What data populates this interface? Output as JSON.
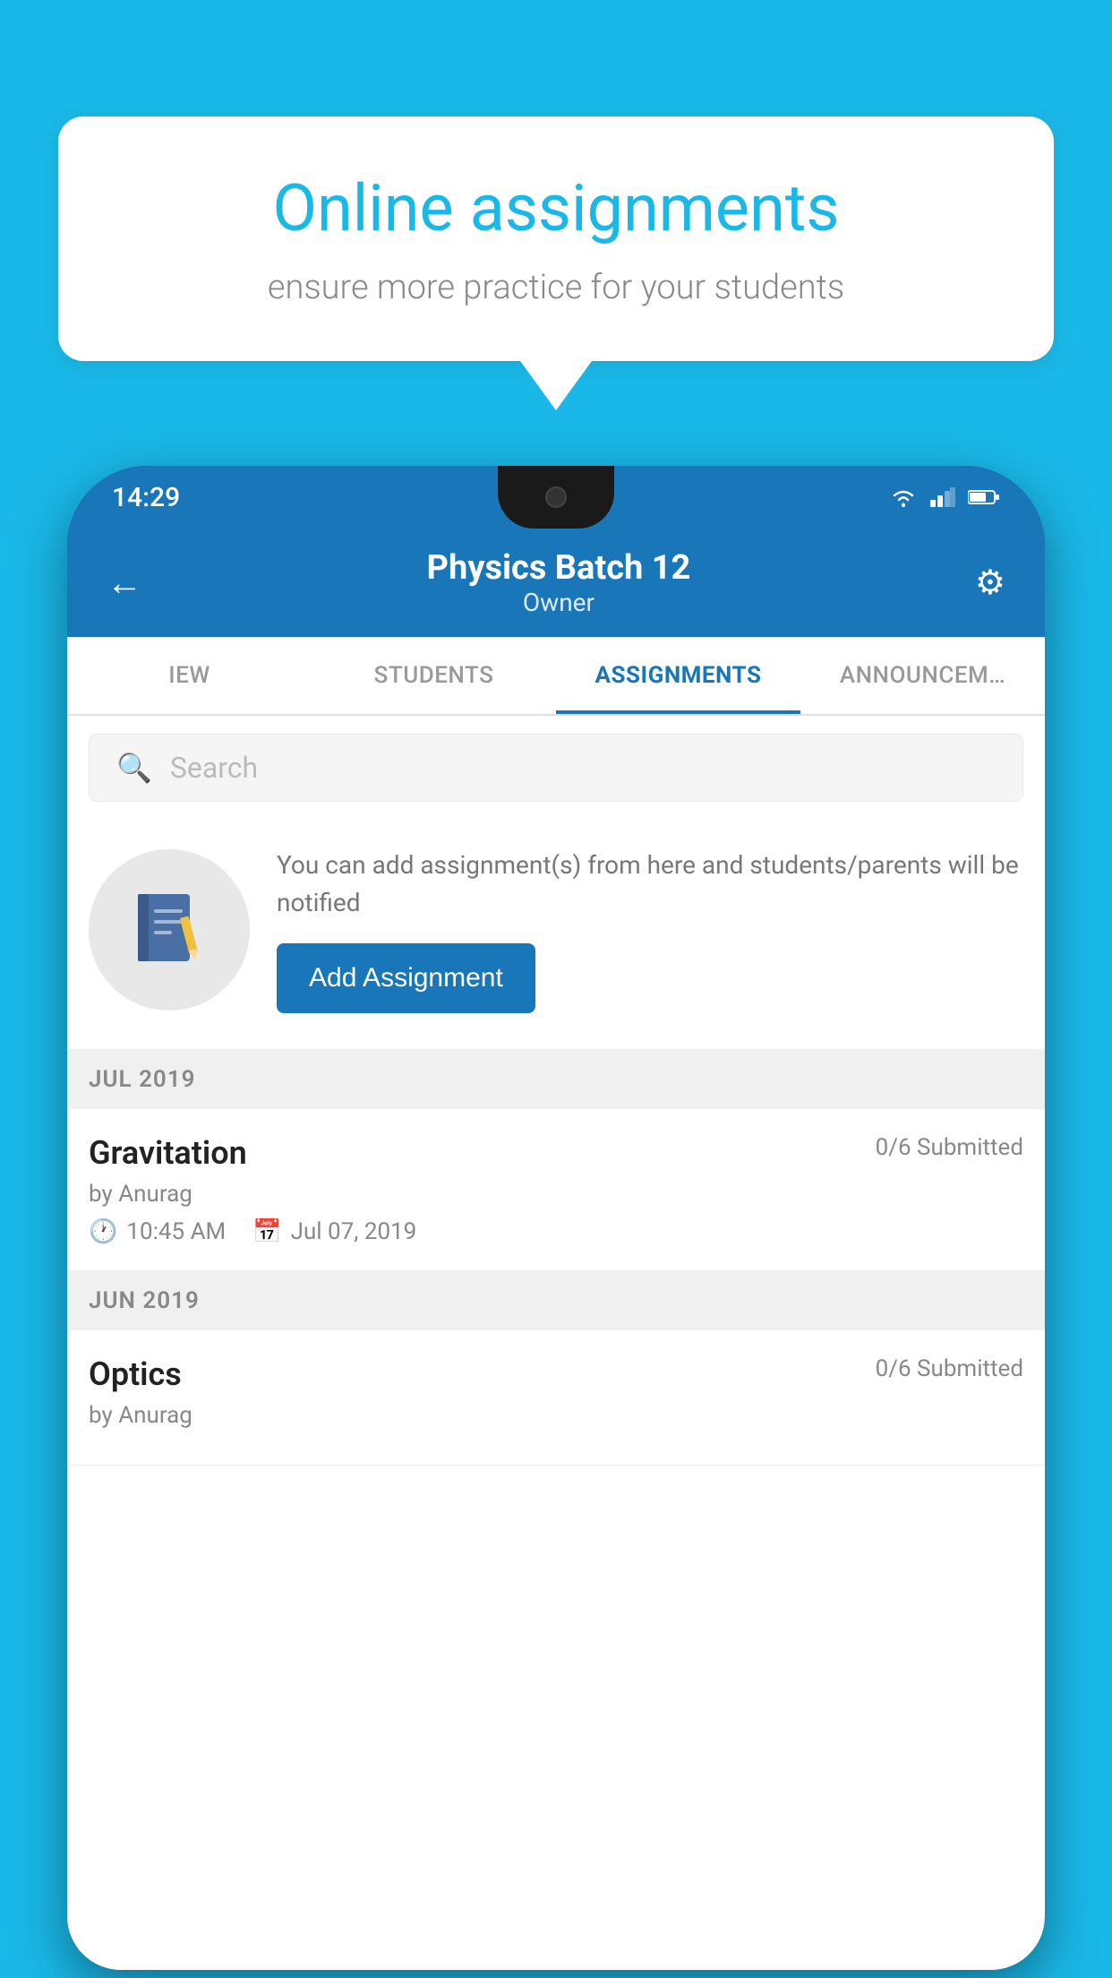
{
  "background_color": "#1ab8e8",
  "speech_bubble": {
    "title": "Online assignments",
    "subtitle": "ensure more practice for your students"
  },
  "status_bar": {
    "time": "14:29",
    "icons": [
      "wifi",
      "signal",
      "battery"
    ]
  },
  "app_header": {
    "back_label": "←",
    "title": "Physics Batch 12",
    "subtitle": "Owner",
    "settings_icon": "⚙"
  },
  "tabs": [
    {
      "label": "IEW",
      "active": false
    },
    {
      "label": "STUDENTS",
      "active": false
    },
    {
      "label": "ASSIGNMENTS",
      "active": true
    },
    {
      "label": "ANNOUNCEM…",
      "active": false
    }
  ],
  "search": {
    "placeholder": "Search",
    "icon": "🔍"
  },
  "promo": {
    "description": "You can add assignment(s) from here and students/parents will be notified",
    "add_button_label": "Add Assignment"
  },
  "sections": [
    {
      "label": "JUL 2019",
      "assignments": [
        {
          "name": "Gravitation",
          "submitted": "0/6 Submitted",
          "author": "by Anurag",
          "time": "10:45 AM",
          "date": "Jul 07, 2019"
        }
      ]
    },
    {
      "label": "JUN 2019",
      "assignments": [
        {
          "name": "Optics",
          "submitted": "0/6 Submitted",
          "author": "by Anurag",
          "time": "",
          "date": ""
        }
      ]
    }
  ]
}
